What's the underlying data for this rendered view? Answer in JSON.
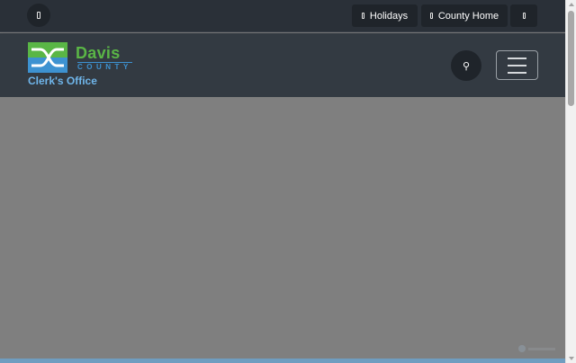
{
  "topbar": {
    "left_icon": "translate-icon",
    "buttons": [
      {
        "label": "Holidays",
        "icon": "calendar-icon"
      },
      {
        "label": "County Home",
        "icon": "home-icon"
      },
      {
        "label": "",
        "icon": "accessibility-icon"
      }
    ]
  },
  "header": {
    "logo_main": "Davis",
    "logo_sub": "COUNTY",
    "site_title": "Clerk's Office",
    "search_icon": "search-icon",
    "menu_icon": "hamburger-menu-icon"
  },
  "colors": {
    "topbar_bg": "#2a3038",
    "header_bg": "#333a42",
    "overlay": "#7f7f7f",
    "logo_green": "#5ab646",
    "logo_blue": "#3d92d1",
    "title_blue": "#6fb5ea"
  }
}
